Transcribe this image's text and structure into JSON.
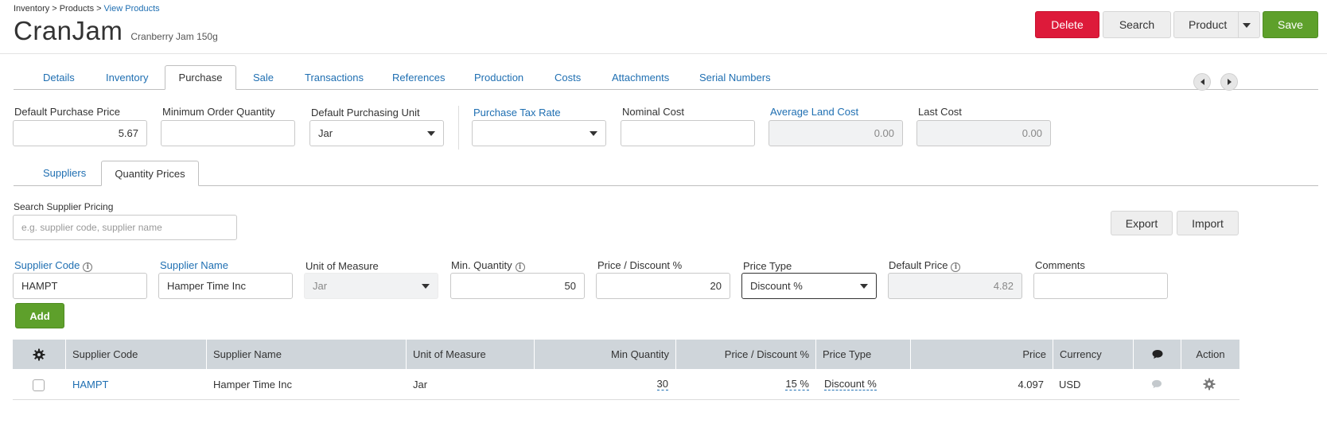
{
  "breadcrumb": {
    "items": [
      "Inventory",
      "Products",
      "View Products"
    ],
    "separator": ">"
  },
  "product": {
    "code": "CranJam",
    "name": "Cranberry Jam 150g"
  },
  "actions": {
    "delete": "Delete",
    "search": "Search",
    "product": "Product",
    "save": "Save"
  },
  "tabs": [
    "Details",
    "Inventory",
    "Purchase",
    "Sale",
    "Transactions",
    "References",
    "Production",
    "Costs",
    "Attachments",
    "Serial Numbers"
  ],
  "active_tab": "Purchase",
  "purchase": {
    "default_purchase_price": {
      "label": "Default Purchase Price",
      "value": "5.67"
    },
    "minimum_order_quantity": {
      "label": "Minimum Order Quantity",
      "value": ""
    },
    "default_purchasing_unit": {
      "label": "Default Purchasing Unit",
      "value": "Jar"
    },
    "purchase_tax_rate": {
      "label": "Purchase Tax Rate",
      "value": ""
    },
    "nominal_cost": {
      "label": "Nominal Cost",
      "value": ""
    },
    "average_land_cost": {
      "label": "Average Land Cost",
      "value": "0.00"
    },
    "last_cost": {
      "label": "Last Cost",
      "value": "0.00"
    }
  },
  "subtabs": [
    "Suppliers",
    "Quantity Prices"
  ],
  "active_subtab": "Quantity Prices",
  "search_supplier": {
    "label": "Search Supplier Pricing",
    "placeholder": "e.g. supplier code, supplier name"
  },
  "buttons": {
    "export": "Export",
    "import": "Import",
    "add": "Add"
  },
  "form": {
    "supplier_code": {
      "label": "Supplier Code",
      "value": "HAMPT"
    },
    "supplier_name": {
      "label": "Supplier Name",
      "value": "Hamper Time Inc"
    },
    "unit_of_measure": {
      "label": "Unit of Measure",
      "value": "Jar"
    },
    "min_quantity": {
      "label": "Min. Quantity",
      "value": "50"
    },
    "price_discount": {
      "label": "Price / Discount %",
      "value": "20"
    },
    "price_type": {
      "label": "Price Type",
      "value": "Discount %"
    },
    "default_price": {
      "label": "Default Price",
      "value": "4.82"
    },
    "comments": {
      "label": "Comments",
      "value": ""
    }
  },
  "table": {
    "headers": [
      "Supplier Code",
      "Supplier Name",
      "Unit of Measure",
      "Min Quantity",
      "Price / Discount %",
      "Price Type",
      "Price",
      "Currency",
      "Action"
    ],
    "rows": [
      {
        "supplier_code": "HAMPT",
        "supplier_name": "Hamper Time Inc",
        "unit": "Jar",
        "min_quantity": "30",
        "price_discount": "15 %",
        "price_type": "Discount %",
        "price": "4.097",
        "currency": "USD"
      }
    ]
  },
  "colors": {
    "link": "#1f6fb2",
    "delete": "#dd1a3a",
    "save": "#5ea02b",
    "table_header": "#cfd5da"
  }
}
